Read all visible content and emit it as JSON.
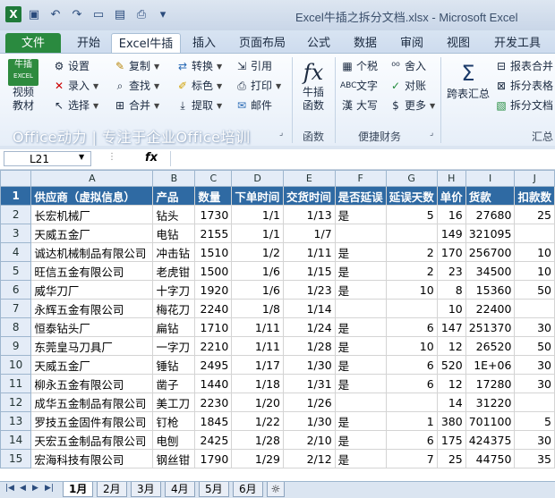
{
  "window": {
    "title": "Excel牛插之拆分文档.xlsx - Microsoft Excel"
  },
  "ribbon_tabs": [
    {
      "label": "文件"
    },
    {
      "label": "开始"
    },
    {
      "label": "Excel牛插"
    },
    {
      "label": "插入"
    },
    {
      "label": "页面布局"
    },
    {
      "label": "公式"
    },
    {
      "label": "数据"
    },
    {
      "label": "审阅"
    },
    {
      "label": "视图"
    },
    {
      "label": "开发工具"
    }
  ],
  "ribbon": {
    "video": {
      "badge_top": "牛插",
      "badge_bottom": "EXCEL",
      "line1": "视频",
      "line2": "教材"
    },
    "settings": "设置",
    "entry": "录入",
    "select": "选择",
    "copy": "复制",
    "find": "查找",
    "merge": "合并",
    "convert": "转换",
    "colorize": "标色",
    "extract": "提取",
    "reference": "引用",
    "print": "打印",
    "mail": "邮件",
    "func": {
      "line1": "牛插",
      "line2": "函数"
    },
    "tax": "个税",
    "text": "文字",
    "upper": "大写",
    "round": "舍入",
    "check": "对账",
    "more": "更多",
    "crosstab": {
      "line1": "跨表汇总"
    },
    "report_merge": "报表合并",
    "split_sheet": "拆分表格",
    "split_doc": "拆分文档",
    "office_bar": "Office动力 | 专注于企业Office培训",
    "group_func": "函数",
    "group_finance": "便捷财务",
    "group_summary": "汇总"
  },
  "formula_bar": {
    "name_box": "L21",
    "fx": "fx"
  },
  "sheet": {
    "columns": [
      "A",
      "B",
      "C",
      "D",
      "E",
      "F",
      "G",
      "H",
      "I",
      "J"
    ],
    "header": [
      "供应商（虚拟信息）",
      "产品",
      "数量",
      "下单时间",
      "交货时间",
      "是否延误",
      "延误天数",
      "单价",
      "货款",
      "扣款数"
    ],
    "rows": [
      [
        "长宏机械厂",
        "钻头",
        "1730",
        "1/1",
        "1/13",
        "是",
        "5",
        "16",
        "27680",
        "25"
      ],
      [
        "天威五金厂",
        "电钻",
        "2155",
        "1/1",
        "1/7",
        "",
        "",
        "149",
        "321095",
        ""
      ],
      [
        "诚达机械制品有限公司",
        "冲击钻",
        "1510",
        "1/2",
        "1/11",
        "是",
        "2",
        "170",
        "256700",
        "10"
      ],
      [
        "旺信五金有限公司",
        "老虎钳",
        "1500",
        "1/6",
        "1/15",
        "是",
        "2",
        "23",
        "34500",
        "10"
      ],
      [
        "威华刀厂",
        "十字刀",
        "1920",
        "1/6",
        "1/23",
        "是",
        "10",
        "8",
        "15360",
        "50"
      ],
      [
        "永辉五金有限公司",
        "梅花刀",
        "2240",
        "1/8",
        "1/14",
        "",
        "",
        "10",
        "22400",
        ""
      ],
      [
        "恒泰钻头厂",
        "扁钻",
        "1710",
        "1/11",
        "1/24",
        "是",
        "6",
        "147",
        "251370",
        "30"
      ],
      [
        "东莞皇马刀具厂",
        "一字刀",
        "2210",
        "1/11",
        "1/28",
        "是",
        "10",
        "12",
        "26520",
        "50"
      ],
      [
        "天威五金厂",
        "锤钻",
        "2495",
        "1/17",
        "1/30",
        "是",
        "6",
        "520",
        "1E+06",
        "30"
      ],
      [
        "柳永五金有限公司",
        "凿子",
        "1440",
        "1/18",
        "1/31",
        "是",
        "6",
        "12",
        "17280",
        "30"
      ],
      [
        "成华五金制品有限公司",
        "美工刀",
        "2230",
        "1/20",
        "1/26",
        "",
        "",
        "14",
        "31220",
        ""
      ],
      [
        "罗技五金固件有限公司",
        "钉枪",
        "1845",
        "1/22",
        "1/30",
        "是",
        "1",
        "380",
        "701100",
        "5"
      ],
      [
        "天宏五金制品有限公司",
        "电刨",
        "2425",
        "1/28",
        "2/10",
        "是",
        "6",
        "175",
        "424375",
        "30"
      ],
      [
        "宏海科技有限公司",
        "钢丝钳",
        "1790",
        "1/29",
        "2/12",
        "是",
        "7",
        "25",
        "44750",
        "35"
      ]
    ]
  },
  "sheet_tabs": [
    {
      "label": "1月"
    },
    {
      "label": "2月"
    },
    {
      "label": "3月"
    },
    {
      "label": "4月"
    },
    {
      "label": "5月"
    },
    {
      "label": "6月"
    }
  ],
  "colors": {
    "header_fill": "#2f6aa3",
    "file_tab": "#2a8a3f"
  }
}
